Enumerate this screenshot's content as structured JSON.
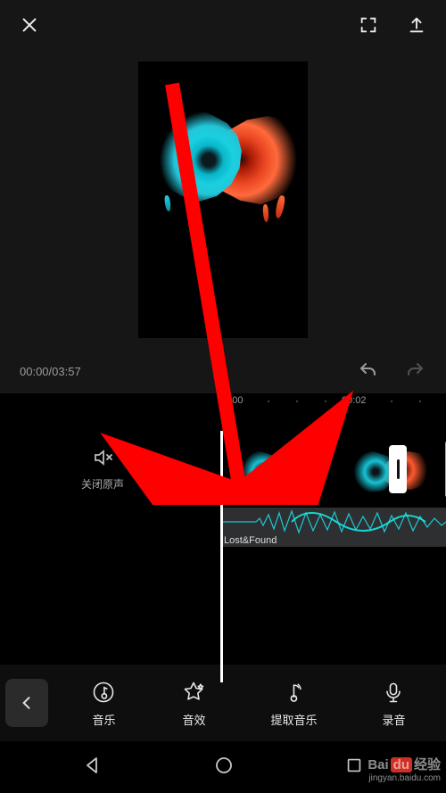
{
  "topbar": {
    "close": "close",
    "expand": "expand",
    "export": "export"
  },
  "playback": {
    "current": "00:00",
    "total": "03:57",
    "separator": "/"
  },
  "ruler": {
    "t0": "00:00",
    "t1": "00:02"
  },
  "mute": {
    "label": "关闭原声"
  },
  "audio": {
    "track_name": "Lost&Found"
  },
  "tools": {
    "music": "音乐",
    "sfx": "音效",
    "extract": "提取音乐",
    "record": "录音"
  },
  "watermark": {
    "brand_left": "Bai",
    "brand_mid": "du",
    "brand_right": "经验",
    "url": "jingyan.baidu.com"
  }
}
